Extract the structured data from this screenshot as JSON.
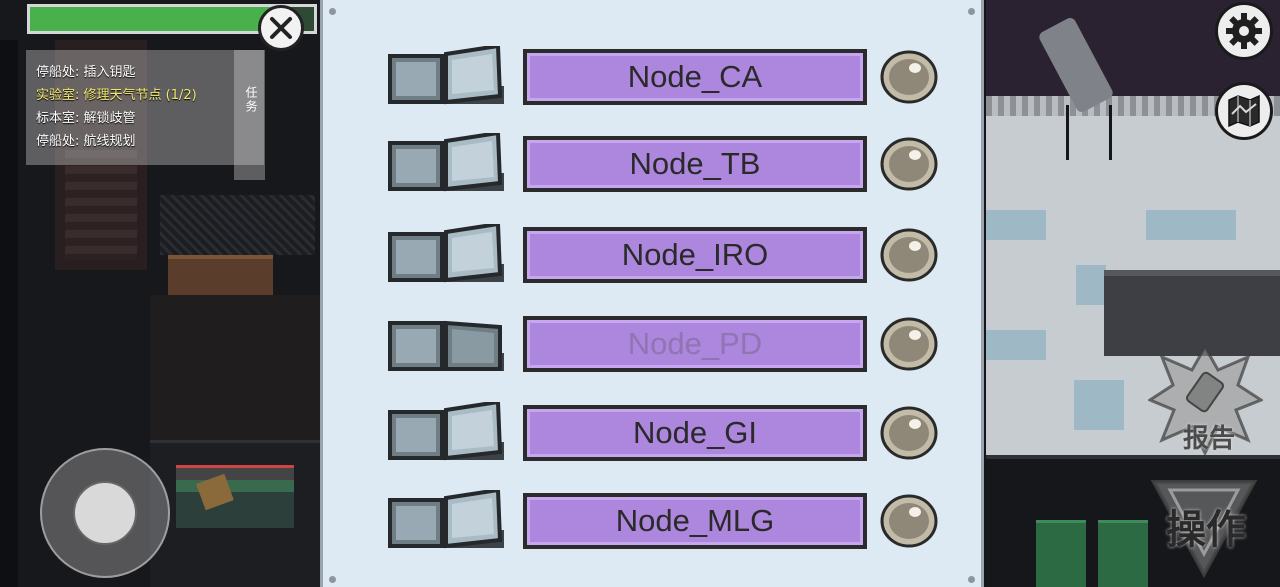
{
  "hud": {
    "task_progress": 0.9,
    "tasks_tab_label": "任务",
    "tasks": [
      {
        "text": "停船处: 插入钥匙",
        "active": false
      },
      {
        "text": "实验室: 修理天气节点 (1/2)",
        "active": true
      },
      {
        "text": "标本室: 解锁歧管",
        "active": false
      },
      {
        "text": "停船处: 航线规划",
        "active": false
      }
    ],
    "close_icon": "close-x-icon",
    "settings_icon": "gear-icon",
    "map_icon": "map-icon",
    "report_label": "报告",
    "use_label": "操作"
  },
  "weather_nodes": [
    {
      "label": "Node_CA",
      "switch_state": "up",
      "dim": false
    },
    {
      "label": "Node_TB",
      "switch_state": "up",
      "dim": false
    },
    {
      "label": "Node_IRO",
      "switch_state": "up",
      "dim": false
    },
    {
      "label": "Node_PD",
      "switch_state": "down",
      "dim": true
    },
    {
      "label": "Node_GI",
      "switch_state": "up",
      "dim": false
    },
    {
      "label": "Node_MLG",
      "switch_state": "up",
      "dim": false
    }
  ],
  "colors": {
    "label_fill": "#ad86dd",
    "panel_bg": "#dde9f3",
    "progress_fill": "#49b14b",
    "active_task": "#f2e86a"
  }
}
